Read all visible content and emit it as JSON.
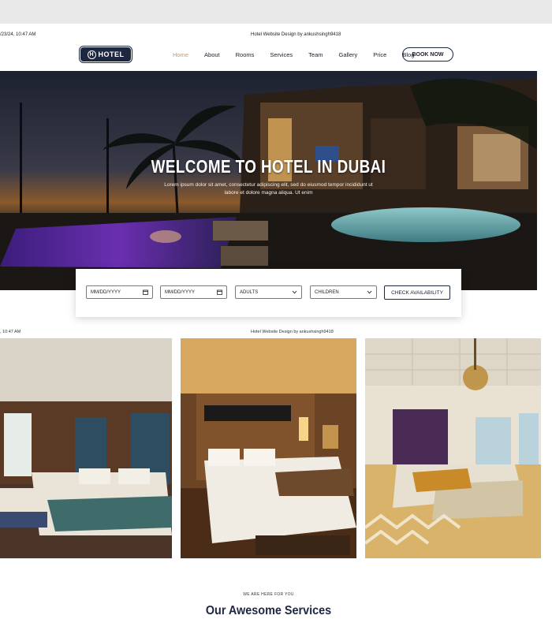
{
  "print_header": {
    "date": "/23/24, 10:47 AM",
    "title": "Hotel Website Design by ankushsingh9418"
  },
  "brand": {
    "logo_letter": "H",
    "logo_text": "HOTEL"
  },
  "nav": {
    "items": [
      "Home",
      "About",
      "Rooms",
      "Services",
      "Team",
      "Gallery",
      "Price",
      "Blog"
    ],
    "active": "Home",
    "book_button": "BOOK NOW"
  },
  "hero": {
    "title": "WELCOME TO HOTEL IN DUBAI",
    "subtitle": "Lorem ipsum dolor sit amet, consectetur adipiscing elit, sed do eiusmod tempor incididunt ut labore et dolore magna aliqua. Ut enim"
  },
  "booking": {
    "checkin_placeholder": "MM/DD/YYYY",
    "checkout_placeholder": "MM/DD/YYYY",
    "adults_label": "ADULTS",
    "children_label": "CHILDREN",
    "check_button": "CHECK AVAILABILITY"
  },
  "print_header_2": {
    "date": ", 10:47 AM",
    "title": "Hotel Website Design by ankushsingh9418"
  },
  "services": {
    "eyebrow": "WE ARE HERE FOR YOU",
    "title": "Our Awesome Services"
  },
  "colors": {
    "navy": "#1d2740",
    "gold_accent": "#c69b53"
  }
}
